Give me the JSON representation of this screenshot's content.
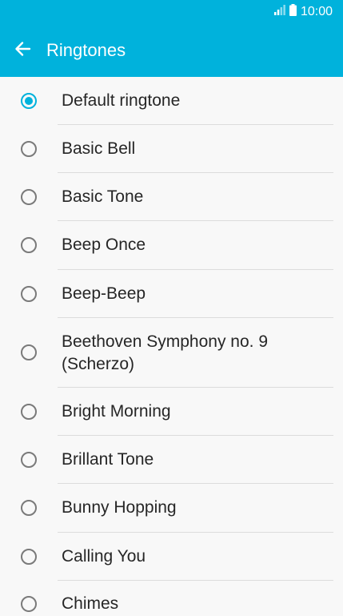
{
  "status_bar": {
    "time": "10:00",
    "icons": [
      "signal-icon",
      "battery-icon"
    ]
  },
  "app_bar": {
    "title": "Ringtones",
    "back_icon": "arrow-left-icon"
  },
  "colors": {
    "accent": "#00b2dc",
    "text": "#262626",
    "background": "#f8f8f8",
    "divider": "#dcdcdc"
  },
  "ringtones": {
    "selected": "Default ringtone",
    "items": [
      {
        "label": "Default ringtone",
        "checked": true
      },
      {
        "label": "Basic Bell",
        "checked": false
      },
      {
        "label": "Basic Tone",
        "checked": false
      },
      {
        "label": "Beep Once",
        "checked": false
      },
      {
        "label": "Beep-Beep",
        "checked": false
      },
      {
        "label": "Beethoven Symphony no. 9 (Scherzo)",
        "checked": false
      },
      {
        "label": "Bright Morning",
        "checked": false
      },
      {
        "label": "Brillant Tone",
        "checked": false
      },
      {
        "label": "Bunny Hopping",
        "checked": false
      },
      {
        "label": "Calling You",
        "checked": false
      },
      {
        "label": "Chimes",
        "checked": false
      }
    ]
  }
}
